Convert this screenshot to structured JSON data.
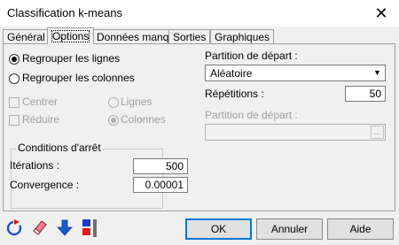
{
  "window": {
    "title": "Classification k-means",
    "close_glyph": "✕"
  },
  "tabs": [
    {
      "label": "Général"
    },
    {
      "label": "Options"
    },
    {
      "label": "Données manq."
    },
    {
      "label": "Sorties"
    },
    {
      "label": "Graphiques"
    }
  ],
  "grouping": {
    "rows_label": "Regrouper les lignes",
    "cols_label": "Regrouper les colonnes",
    "selected": "rows"
  },
  "transform": {
    "center_label": "Centrer",
    "reduce_label": "Réduire",
    "lines_label": "Lignes",
    "columns_label": "Colonnes"
  },
  "stop_conditions": {
    "title": "Conditions d'arrêt",
    "iterations_label": "Itérations :",
    "iterations_value": "500",
    "convergence_label": "Convergence :",
    "convergence_value": "0.00001"
  },
  "partition": {
    "label": "Partition de départ :",
    "value": "Aléatoire",
    "repetitions_label": "Répétitions :",
    "repetitions_value": "50",
    "label2": "Partition de départ :",
    "dots": "..."
  },
  "footer": {
    "ok": "OK",
    "cancel": "Annuler",
    "help": "Aide",
    "icons": [
      "reset-icon",
      "eraser-icon",
      "arrow-down-icon",
      "color-flags-icon"
    ]
  }
}
